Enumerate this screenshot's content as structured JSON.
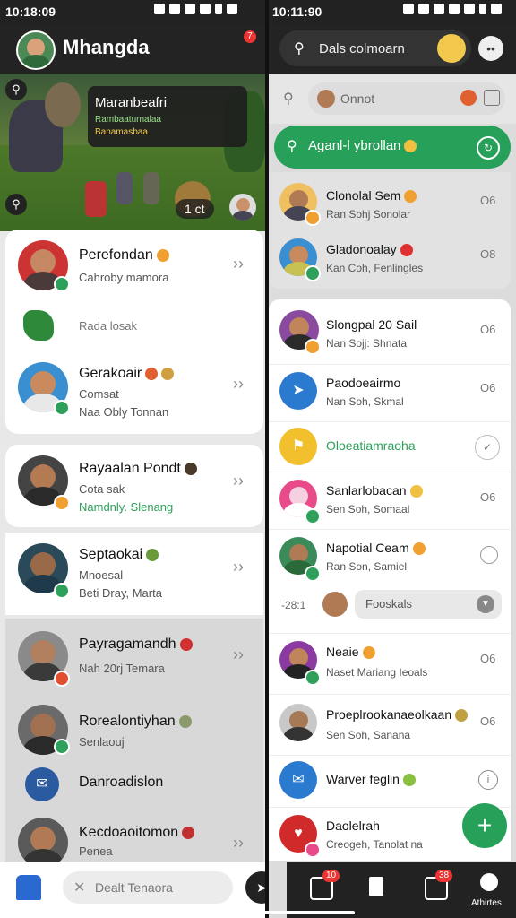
{
  "left": {
    "status_time": "10:18:09",
    "header_title": "Mhangda",
    "header_badge": "7",
    "banner": {
      "title": "Maranbeafri",
      "line1": "Rambaaturnalaa",
      "line2": "Banamasbaa",
      "score": "1 ct"
    },
    "cards": [
      {
        "name": "Perefondan",
        "sub": "Cahroby mamora"
      },
      {
        "name": "Rada losak",
        "sub": ""
      },
      {
        "name": "Gerakoair",
        "sub": "Comsat",
        "sub2": "Naa Obly Tonnan"
      },
      {
        "name": "Rayaalan Pondt",
        "sub": "Cota sak",
        "sub2": "Namdnly. Slenang"
      },
      {
        "name": "Septaokai",
        "sub": "Mnoesal",
        "sub2": "Beti Dray, Marta"
      },
      {
        "name": "Payragamandh",
        "sub": "Nah 20rj Temara"
      },
      {
        "name": "Rorealontiyhan",
        "sub": "Senlaouj"
      },
      {
        "name": "Danroadislon",
        "sub": ""
      },
      {
        "name": "Kecdoaoitomon",
        "sub": "Penea"
      }
    ],
    "bottom_search": "Dealt Tenaora"
  },
  "right": {
    "status_time": "10:11:90",
    "search_placeholder": "Dals colmoarn",
    "search2_placeholder": "Onnot",
    "highlight_label": "Aganl-l ybrollan",
    "items": [
      {
        "name": "Clonolal Sem",
        "sub": "Ran Sohj Sonolar",
        "time": "O6"
      },
      {
        "name": "Gladonoalay",
        "sub": "Kan Coh, Fenlingles",
        "time": "O8"
      },
      {
        "name": "Slongpal 20 Sail",
        "sub": "Nan Sojj: Shnata",
        "time": "O6"
      },
      {
        "name": "Paodoeairmo",
        "sub": "Nan Soh, Skmal",
        "time": "O6"
      },
      {
        "name": "Oloeatiamraoha",
        "sub": "",
        "time": ""
      },
      {
        "name": "Sanlarlobacan",
        "sub": "Sen Soh, Somaal",
        "time": "O6"
      },
      {
        "name": "Napotial Ceam",
        "sub": "Ran Son, Samiel",
        "time": ""
      },
      {
        "name": "Neaie",
        "sub": "Naset Mariang Ieoals",
        "time": "O6"
      },
      {
        "name": "Proeplrookanaeolkaan",
        "sub": "Sen Soh, Sanana",
        "time": "O6"
      },
      {
        "name": "Warver feglin",
        "sub": "",
        "time": ""
      },
      {
        "name": "Daolelrah",
        "sub": "Creogeh, Tanolat na",
        "time": ""
      }
    ],
    "reply_chip": "Fooskals",
    "reply_prefix": "-28:1",
    "nav_badge1": "10",
    "nav_badge2": "38",
    "nav_label": "Athirtes"
  }
}
